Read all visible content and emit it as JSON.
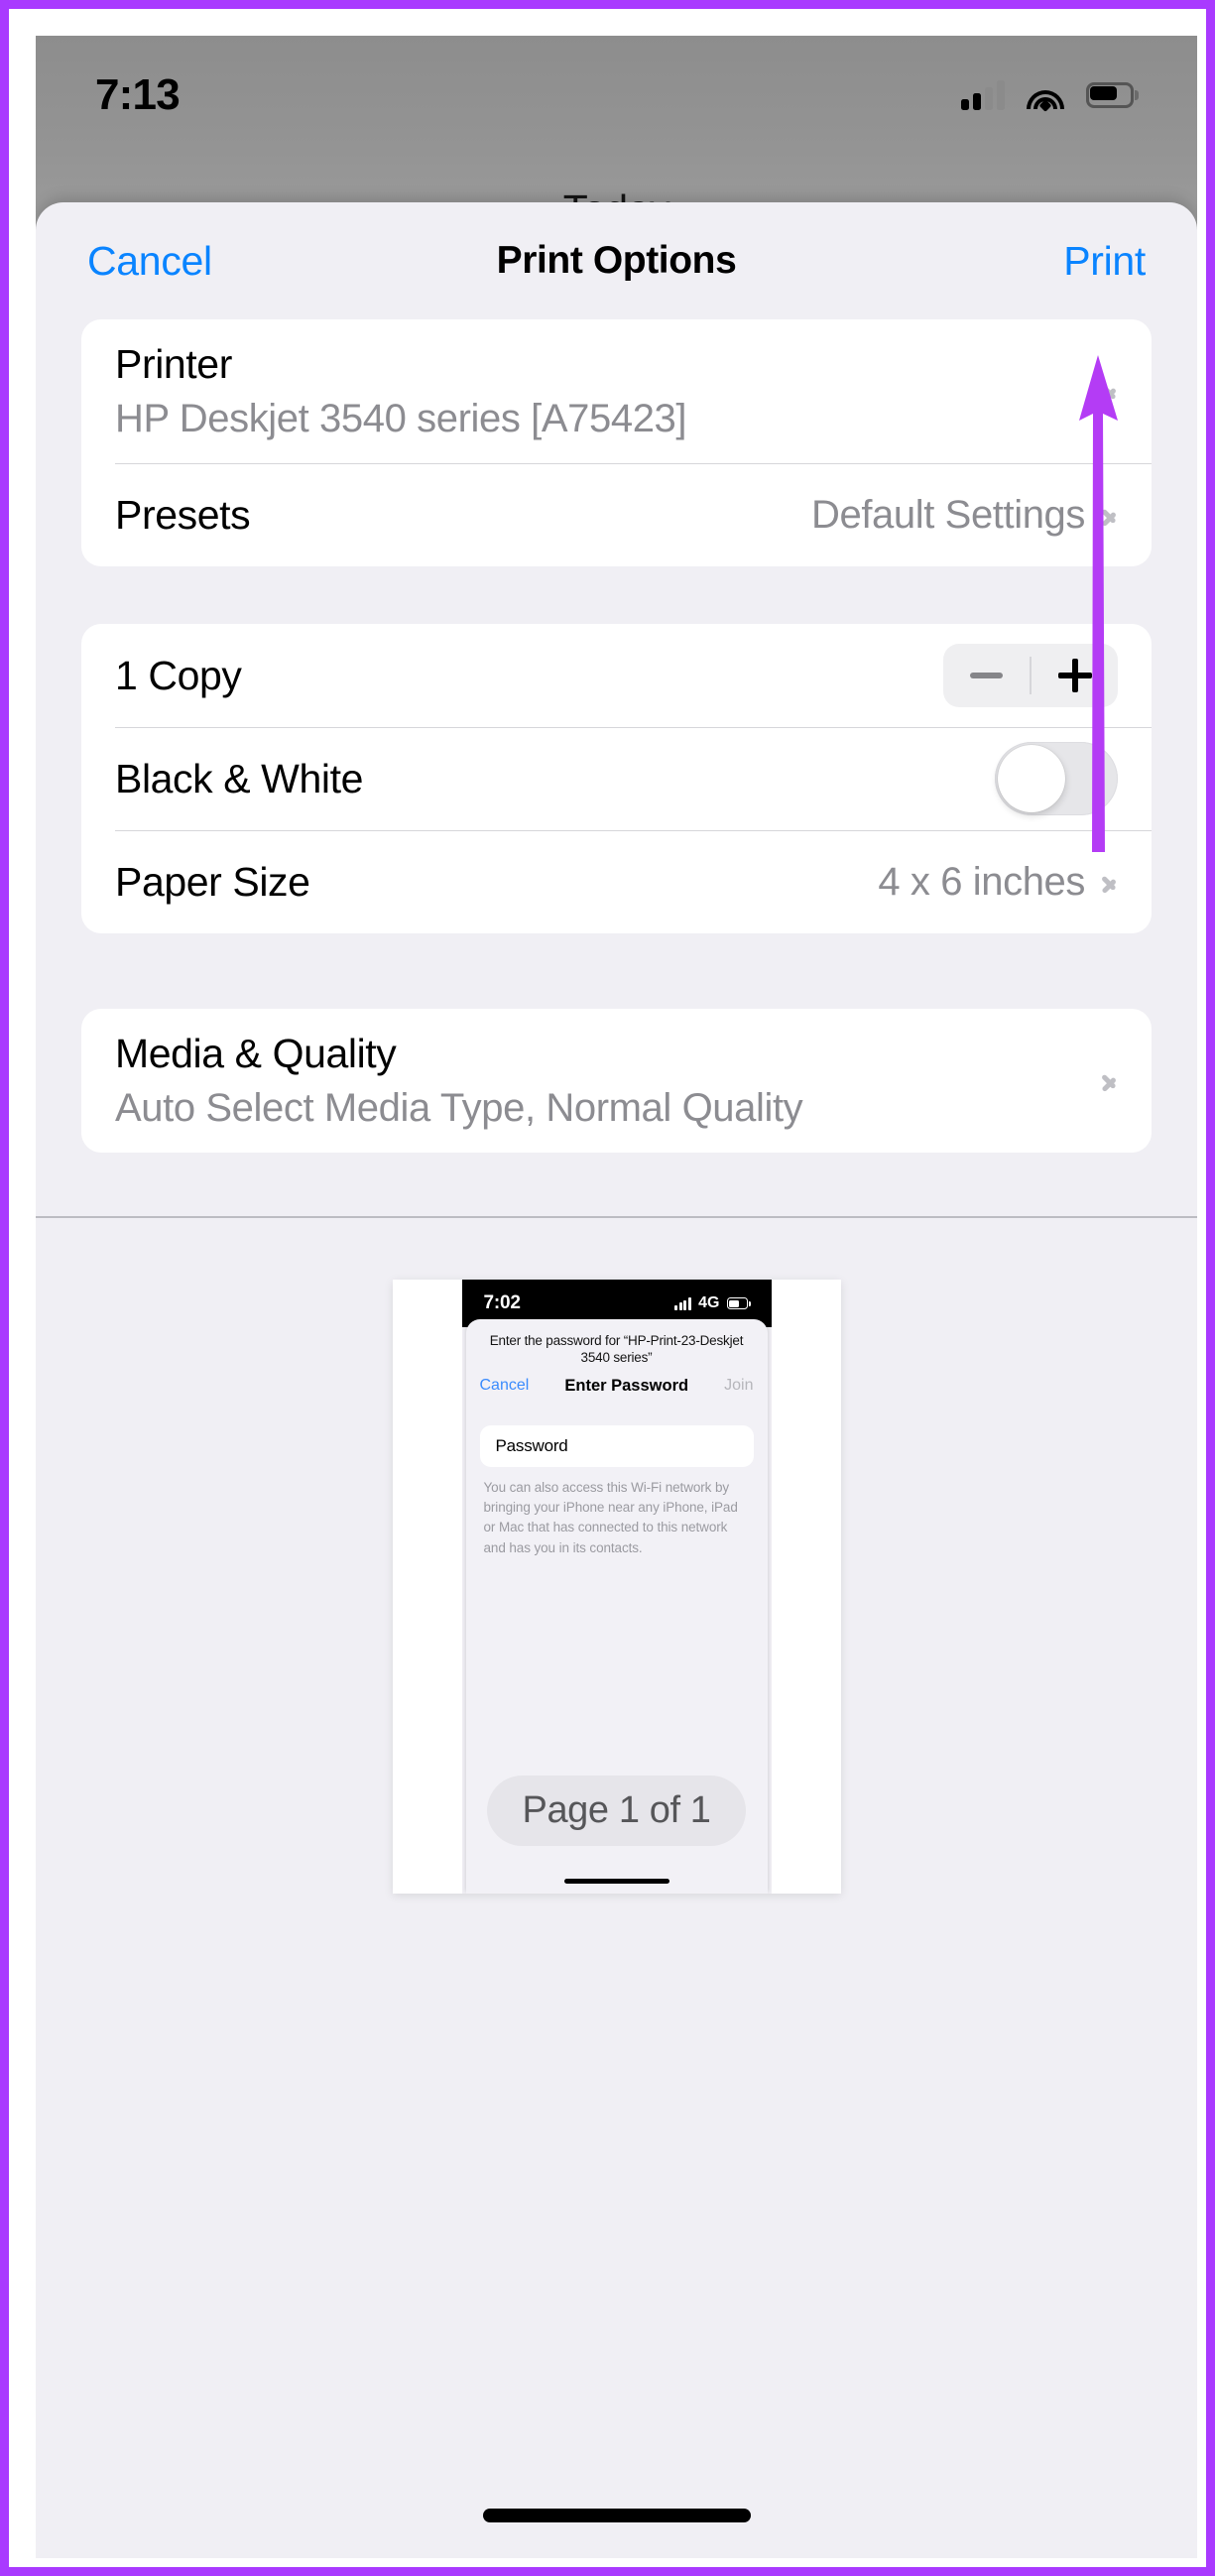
{
  "annotation": {
    "frame_color": "#a93aff",
    "arrow_color": "#b43cf5",
    "arrow_target": "print-button"
  },
  "status_bar": {
    "time": "7:13",
    "cellular_icon": "cellular-signal-icon",
    "cellular_bars_filled": 2,
    "wifi_icon": "wifi-icon",
    "battery_icon": "battery-icon",
    "battery_level_pct": 62
  },
  "backdrop": {
    "label": "Today"
  },
  "sheet": {
    "title": "Print Options",
    "cancel_label": "Cancel",
    "print_label": "Print",
    "accent_color": "#0a84ff",
    "groups": [
      {
        "name": "printer-group",
        "rows": [
          {
            "name": "printer-row",
            "title": "Printer",
            "subtitle": "HP Deskjet 3540 series [A75423]",
            "accessory": "chevron-right-icon"
          },
          {
            "name": "presets-row",
            "title": "Presets",
            "value": "Default Settings",
            "accessory": "chevron-right-icon"
          }
        ]
      },
      {
        "name": "options-group",
        "rows": [
          {
            "name": "copies-row",
            "title": "1 Copy",
            "accessory": "stepper",
            "minus_label": "−",
            "plus_label": "+",
            "minus_enabled": false,
            "plus_enabled": true
          },
          {
            "name": "black-white-row",
            "title": "Black & White",
            "accessory": "toggle",
            "toggle_on": false
          },
          {
            "name": "paper-size-row",
            "title": "Paper Size",
            "value": "4 x 6 inches",
            "accessory": "chevron-right-icon"
          }
        ]
      },
      {
        "name": "media-quality-group",
        "rows": [
          {
            "name": "media-quality-row",
            "title": "Media & Quality",
            "subtitle": "Auto Select Media Type, Normal Quality",
            "accessory": "chevron-right-icon"
          }
        ]
      }
    ]
  },
  "preview": {
    "page_badge": "Page 1 of 1",
    "document": {
      "status_bar": {
        "time": "7:02",
        "network": "4G",
        "cellular_icon": "cellular-signal-icon",
        "battery_icon": "battery-icon"
      },
      "prompt": "Enter the password for “HP-Print-23-Deskjet 3540 series”",
      "nav": {
        "cancel_label": "Cancel",
        "title": "Enter Password",
        "join_label": "Join"
      },
      "password_field_placeholder": "Password",
      "help_text": "You can also access this Wi-Fi network by bringing your iPhone near any iPhone, iPad or Mac that has connected to this network and has you in its contacts."
    }
  }
}
